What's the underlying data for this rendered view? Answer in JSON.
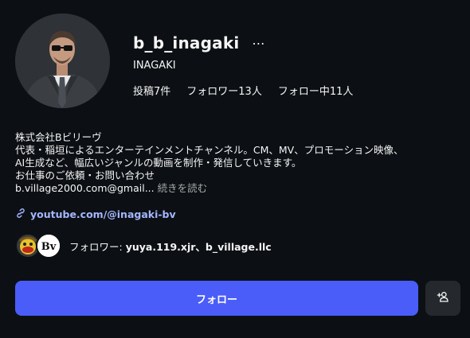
{
  "profile": {
    "username": "b_b_inagaki",
    "more_icon": "…",
    "full_name": "INAGAKI",
    "stats": {
      "posts": "投稿7件",
      "followers": "フォロワー13人",
      "following": "フォロー中11人"
    }
  },
  "bio": {
    "lines": [
      "株式会社Bビリーヴ",
      "代表・稲垣によるエンターテインメントチャンネル。CM、MV、プロモーション映像、",
      "AI生成など、幅広いジャンルの動画を制作・発信していきます。",
      "お仕事のご依頼・お問い合わせ"
    ],
    "email_truncated": "b.village2000.com@gmail...",
    "more_label": "続きを読む"
  },
  "link": {
    "icon": "link-icon",
    "text": "youtube.com/@inagaki-bv"
  },
  "followed_by": {
    "prefix": "フォロワー: ",
    "names": "yuya.119.xjr、b_village.llc",
    "avatar2_text": "Bv"
  },
  "actions": {
    "follow_label": "フォロー",
    "suggest_icon": "add-person-icon"
  },
  "colors": {
    "background": "#0c1014",
    "accent": "#4a5df9",
    "link": "#a6b6ff",
    "secondary_button": "#25292e"
  }
}
